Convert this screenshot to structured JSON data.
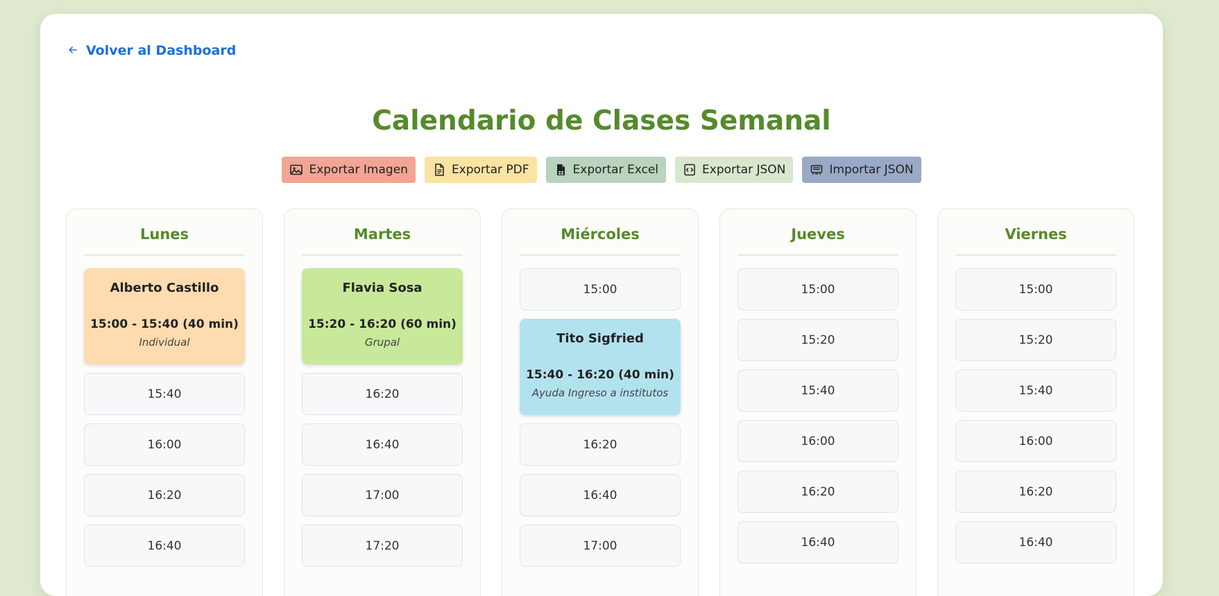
{
  "nav": {
    "back_label": "Volver al Dashboard"
  },
  "title": "Calendario de Clases Semanal",
  "toolbar": [
    {
      "label": "Exportar Imagen",
      "icon": "image-icon",
      "color": "#f2a594"
    },
    {
      "label": "Exportar PDF",
      "icon": "document-icon",
      "color": "#fbe3a1"
    },
    {
      "label": "Exportar Excel",
      "icon": "excel-file-icon",
      "color": "#b9d3bd"
    },
    {
      "label": "Exportar JSON",
      "icon": "code-file-icon",
      "color": "#d8e8cf"
    },
    {
      "label": "Importar JSON",
      "icon": "import-icon",
      "color": "#9aa9c6"
    }
  ],
  "days": [
    {
      "name": "Lunes",
      "items": [
        {
          "kind": "booking",
          "student": "Alberto Castillo",
          "time": "15:00 - 15:40 (40 min)",
          "type": "Individual",
          "color": "#ffdcaf"
        },
        {
          "kind": "slot",
          "time": "15:40"
        },
        {
          "kind": "slot",
          "time": "16:00"
        },
        {
          "kind": "slot",
          "time": "16:20"
        },
        {
          "kind": "slot",
          "time": "16:40"
        }
      ]
    },
    {
      "name": "Martes",
      "items": [
        {
          "kind": "booking",
          "student": "Flavia Sosa",
          "time": "15:20 - 16:20 (60 min)",
          "type": "Grupal",
          "color": "#c8e89a"
        },
        {
          "kind": "slot",
          "time": "16:20"
        },
        {
          "kind": "slot",
          "time": "16:40"
        },
        {
          "kind": "slot",
          "time": "17:00"
        },
        {
          "kind": "slot",
          "time": "17:20"
        }
      ]
    },
    {
      "name": "Miércoles",
      "items": [
        {
          "kind": "slot",
          "time": "15:00"
        },
        {
          "kind": "booking",
          "student": "Tito Sigfried",
          "time": "15:40 - 16:20 (40 min)",
          "type": "Ayuda Ingreso a institutos",
          "color": "#b3e2ef"
        },
        {
          "kind": "slot",
          "time": "16:20"
        },
        {
          "kind": "slot",
          "time": "16:40"
        },
        {
          "kind": "slot",
          "time": "17:00"
        }
      ]
    },
    {
      "name": "Jueves",
      "items": [
        {
          "kind": "slot",
          "time": "15:00"
        },
        {
          "kind": "slot",
          "time": "15:20"
        },
        {
          "kind": "slot",
          "time": "15:40"
        },
        {
          "kind": "slot",
          "time": "16:00"
        },
        {
          "kind": "slot",
          "time": "16:20"
        },
        {
          "kind": "slot",
          "time": "16:40"
        }
      ]
    },
    {
      "name": "Viernes",
      "items": [
        {
          "kind": "slot",
          "time": "15:00"
        },
        {
          "kind": "slot",
          "time": "15:20"
        },
        {
          "kind": "slot",
          "time": "15:40"
        },
        {
          "kind": "slot",
          "time": "16:00"
        },
        {
          "kind": "slot",
          "time": "16:20"
        },
        {
          "kind": "slot",
          "time": "16:40"
        }
      ]
    }
  ]
}
